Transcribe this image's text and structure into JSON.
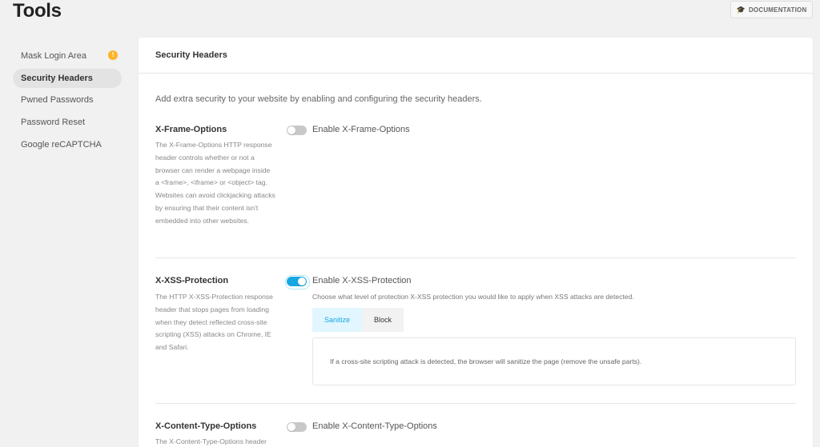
{
  "header": {
    "title": "Tools",
    "documentation_label": "DOCUMENTATION",
    "documentation_icon": "graduation-cap-icon"
  },
  "sidebar": {
    "items": [
      {
        "label": "Mask Login Area",
        "warning": true
      },
      {
        "label": "Security Headers",
        "active": true
      },
      {
        "label": "Pwned Passwords"
      },
      {
        "label": "Password Reset"
      },
      {
        "label": "Google reCAPTCHA"
      }
    ],
    "warning_color": "#fdb42a"
  },
  "card": {
    "title": "Security Headers",
    "intro": "Add extra security to your website by enabling and configuring the security headers."
  },
  "sections": [
    {
      "title": "X-Frame-Options",
      "description": "The X-Frame-Options HTTP response header controls whether or not a browser can render a webpage inside a <frame>, <iframe> or <object> tag. Websites can avoid clickjacking attacks by ensuring that their content isn't embedded into other websites.",
      "toggle_label": "Enable X-Frame-Options",
      "enabled": false
    },
    {
      "title": "X-XSS-Protection",
      "description": "The HTTP X-XSS-Protection response header that stops pages from loading when they detect reflected cross-site scripting (XSS) attacks on Chrome, IE and Safari.",
      "toggle_label": "Enable X-XSS-Protection",
      "enabled": true,
      "sub_description": "Choose what level of protection X-XSS protection you would like to apply when XSS attacks are detected.",
      "tabs": [
        "Sanitize",
        "Block"
      ],
      "selected_tab": "Sanitize",
      "info": "If a cross-site scripting attack is detected, the browser will sanitize the page (remove the unsafe parts)."
    },
    {
      "title": "X-Content-Type-Options",
      "description": "The X-Content-Type-Options header",
      "toggle_label": "Enable X-Content-Type-Options",
      "enabled": false
    }
  ],
  "colors": {
    "accent": "#17a8e3",
    "toggle_off": "#c8c8c8",
    "background": "#f1f1f1"
  }
}
